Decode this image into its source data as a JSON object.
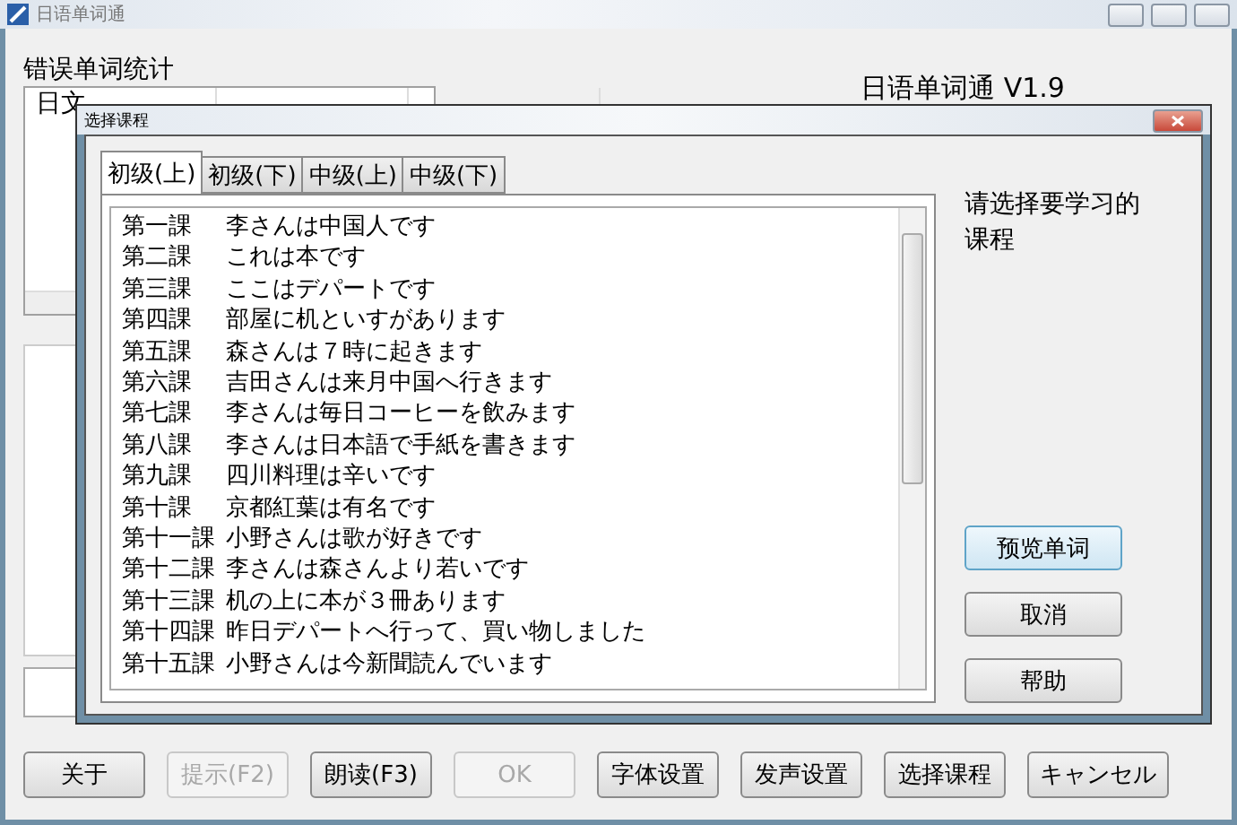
{
  "main_window": {
    "title": "日语单词通",
    "error_stats_label": "错误单词统计",
    "columns": [
      "日文"
    ],
    "app_title": "日语单词通 V1.9",
    "buttons": [
      {
        "label": "关于",
        "disabled": false
      },
      {
        "label": "提示(F2)",
        "disabled": true
      },
      {
        "label": "朗读(F3)",
        "disabled": false
      },
      {
        "label": "OK",
        "disabled": true
      },
      {
        "label": "字体设置",
        "disabled": false
      },
      {
        "label": "发声设置",
        "disabled": false
      },
      {
        "label": "选择课程",
        "disabled": false
      },
      {
        "label": "キャンセル",
        "disabled": false
      }
    ]
  },
  "dialog": {
    "title": "选择课程",
    "tabs": [
      {
        "label": "初级(上)",
        "selected": true
      },
      {
        "label": "初级(下)",
        "selected": false
      },
      {
        "label": "中级(上)",
        "selected": false
      },
      {
        "label": "中级(下)",
        "selected": false
      }
    ],
    "lessons": [
      {
        "number": "第一課",
        "title": "李さんは中国人です"
      },
      {
        "number": "第二課",
        "title": "これは本です"
      },
      {
        "number": "第三課",
        "title": "ここはデパートです"
      },
      {
        "number": "第四課",
        "title": "部屋に机といすがあります"
      },
      {
        "number": "第五課",
        "title": "森さんは７時に起きます"
      },
      {
        "number": "第六課",
        "title": "吉田さんは来月中国へ行きます"
      },
      {
        "number": "第七課",
        "title": "李さんは毎日コーヒーを飲みます"
      },
      {
        "number": "第八課",
        "title": "李さんは日本語で手紙を書きます"
      },
      {
        "number": "第九課",
        "title": "四川料理は辛いです"
      },
      {
        "number": "第十課",
        "title": "京都紅葉は有名です"
      },
      {
        "number": "第十一課",
        "title": "小野さんは歌が好きです"
      },
      {
        "number": "第十二課",
        "title": "李さんは森さんより若いです"
      },
      {
        "number": "第十三課",
        "title": "机の上に本が３冊あります"
      },
      {
        "number": "第十四課",
        "title": "昨日デパートへ行って、買い物しました"
      },
      {
        "number": "第十五課",
        "title": "小野さんは今新聞読んでいます"
      }
    ],
    "prompt": "请选择要学习的课程",
    "buttons": [
      {
        "label": "预览单词",
        "focused": true
      },
      {
        "label": "取消",
        "focused": false
      },
      {
        "label": "帮助",
        "focused": false
      }
    ]
  }
}
